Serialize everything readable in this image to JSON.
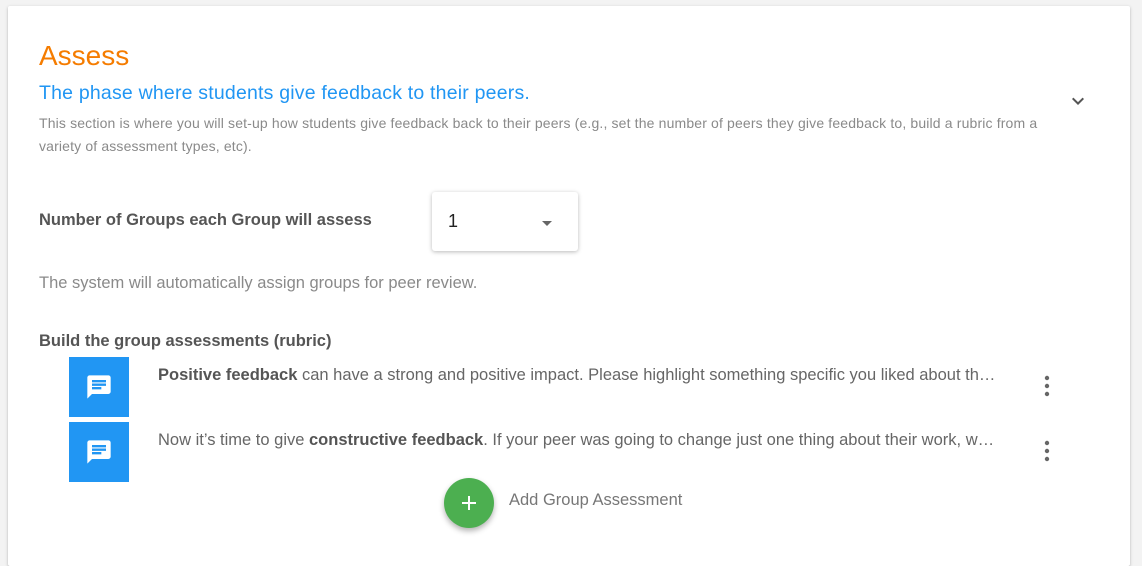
{
  "section": {
    "title": "Assess",
    "subtitle": "The phase where students give feedback to their peers.",
    "description": "This section is where you will set-up how students give feedback back to their peers (e.g., set the number of peers they give feedback to, build a rubric from a variety of assessment types, etc)."
  },
  "groups_setting": {
    "label": "Number of Groups each Group will assess",
    "selected_value": "1",
    "note": "The system will automatically assign groups for peer review."
  },
  "rubric": {
    "label": "Build the group assessments (rubric)",
    "items": [
      {
        "icon": "comment-icon",
        "text_bold": "Positive feedback",
        "text_rest": " can have a strong and positive impact. Please highlight something specific you liked about the work."
      },
      {
        "icon": "comment-icon",
        "text_prefix": "Now it’s time to give ",
        "text_bold": "constructive feedback",
        "text_rest": ". If your peer was going to change just one thing about their work, what would it be?"
      }
    ],
    "add_label": "Add Group Assessment"
  },
  "colors": {
    "title": "#f57c00",
    "subtitle": "#2196f3",
    "icon_box": "#2196f3",
    "add_button": "#4caf50"
  }
}
